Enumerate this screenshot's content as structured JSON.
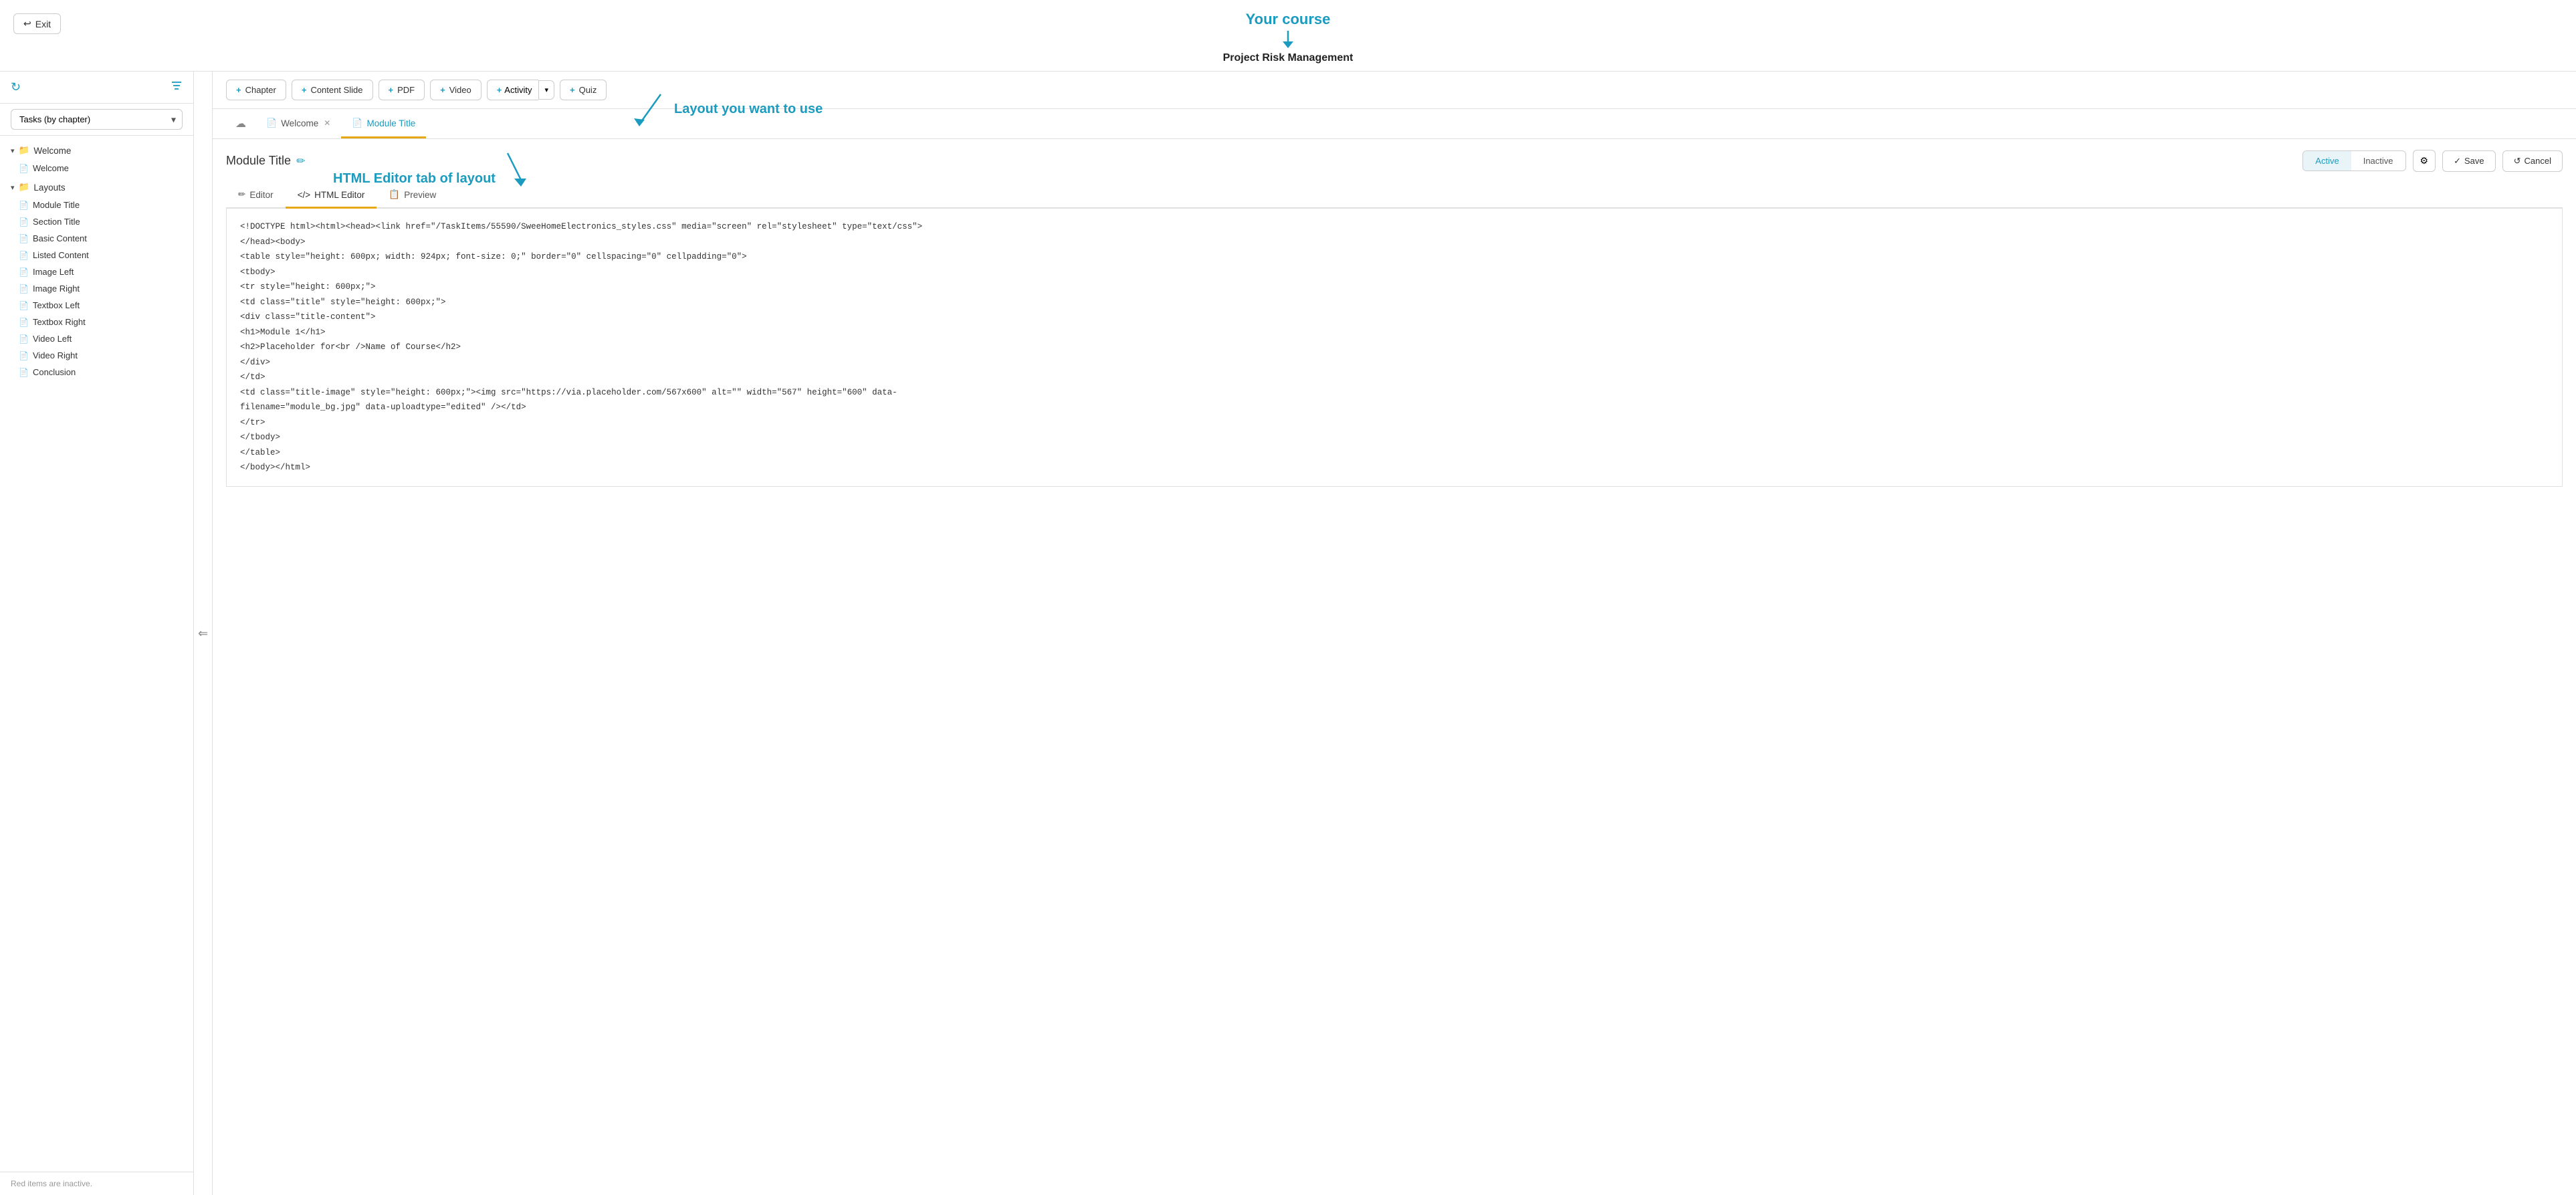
{
  "header": {
    "course_label": "Your course",
    "course_title": "Project Risk Management",
    "exit_label": "Exit"
  },
  "toolbar": {
    "chapter_label": "Chapter",
    "content_slide_label": "Content Slide",
    "pdf_label": "PDF",
    "video_label": "Video",
    "activity_label": "Activity",
    "quiz_label": "Quiz"
  },
  "page_tabs": {
    "welcome_label": "Welcome",
    "module_title_label": "Module Title",
    "annotation_layout": "Layout you want to use"
  },
  "layout_editor": {
    "title": "Module Title",
    "active_label": "Active",
    "inactive_label": "Inactive",
    "save_label": "Save",
    "cancel_label": "Cancel",
    "editor_tab_label": "Editor",
    "html_editor_tab_label": "HTML Editor",
    "preview_tab_label": "Preview",
    "annotation_html": "HTML Editor tab of layout",
    "code_content": "<!DOCTYPE html><html><head><link href=\"/TaskItems/55590/SweeHomeElectronics_styles.css\" media=\"screen\" rel=\"stylesheet\" type=\"text/css\">\n</head><body>\n<table style=\"height: 600px; width: 924px; font-size: 0;\" border=\"0\" cellspacing=\"0\" cellpadding=\"0\">\n<tbody>\n<tr style=\"height: 600px;\">\n<td class=\"title\" style=\"height: 600px;\">\n<div class=\"title-content\">\n<h1>Module 1</h1>\n<h2>Placeholder for<br />Name of Course</h2>\n</div>\n</td>\n<td class=\"title-image\" style=\"height: 600px;\"><img src=\"https://via.placeholder.com/567x600\" alt=\"\" width=\"567\" height=\"600\" data-filename=\"module_bg.jpg\" data-uploadtype=\"edited\" /></td>\n</tr>\n</tbody>\n</table>\n</body></html>"
  },
  "sidebar": {
    "tasks_dropdown_label": "Tasks (by chapter)",
    "footer_note": "Red items are inactive.",
    "nav_items": [
      {
        "type": "folder",
        "label": "Welcome",
        "expanded": true,
        "children": [
          {
            "label": "Welcome",
            "inactive": false
          }
        ]
      },
      {
        "type": "folder",
        "label": "Layouts",
        "expanded": true,
        "children": [
          {
            "label": "Module Title",
            "inactive": false
          },
          {
            "label": "Section Title",
            "inactive": false
          },
          {
            "label": "Basic Content",
            "inactive": false
          },
          {
            "label": "Listed Content",
            "inactive": false
          },
          {
            "label": "Image Left",
            "inactive": false
          },
          {
            "label": "Image Right",
            "inactive": false
          },
          {
            "label": "Textbox Left",
            "inactive": false
          },
          {
            "label": "Textbox Right",
            "inactive": false
          },
          {
            "label": "Video Left",
            "inactive": false
          },
          {
            "label": "Video Right",
            "inactive": false
          },
          {
            "label": "Conclusion",
            "inactive": false
          }
        ]
      }
    ]
  }
}
